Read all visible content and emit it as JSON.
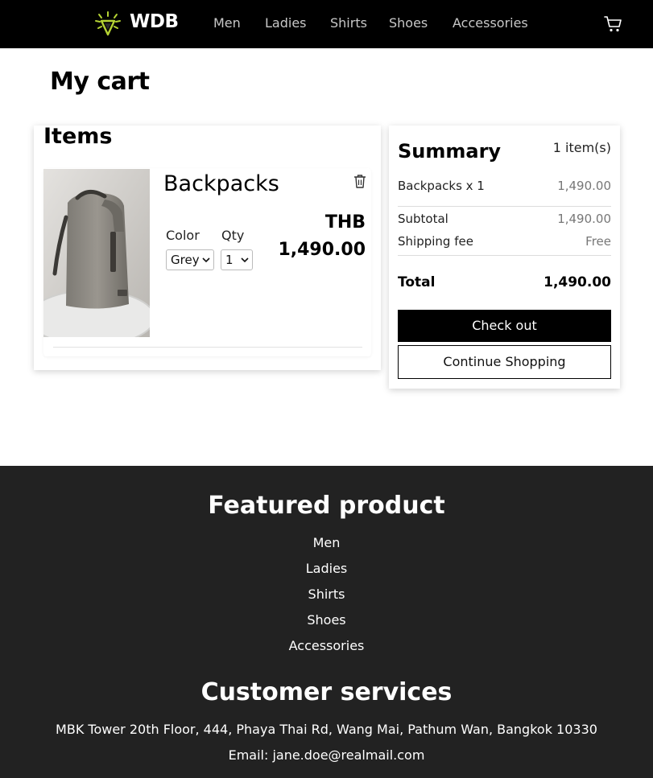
{
  "navbar": {
    "brand": "WDB",
    "links": [
      "Men",
      "Ladies",
      "Shirts",
      "Shoes",
      "Accessories"
    ],
    "logo_icon": "sun-leaf-logo",
    "cart_icon": "shopping-cart-icon"
  },
  "page": {
    "title": "My cart"
  },
  "items": {
    "title": "Items",
    "product": {
      "name": "Backpacks",
      "color_label": "Color",
      "color_value": "Grey",
      "qty_label": "Qty",
      "qty_value": "1",
      "currency": "THB",
      "price": "1,490.00",
      "delete_icon": "trash-icon"
    }
  },
  "summary": {
    "title": "Summary",
    "count": "1 item(s)",
    "line_item_label": "Backpacks x 1",
    "line_item_value": "1,490.00",
    "subtotal_label": "Subtotal",
    "subtotal_value": "1,490.00",
    "shipping_label": "Shipping fee",
    "shipping_value": "Free",
    "total_label": "Total",
    "total_value": "1,490.00",
    "checkout_label": "Check out",
    "continue_label": "Continue Shopping"
  },
  "footer": {
    "featured_title": "Featured product",
    "featured_links": [
      "Men",
      "Ladies",
      "Shirts",
      "Shoes",
      "Accessories"
    ],
    "services_title": "Customer services",
    "address": "MBK Tower 20th Floor, 444, Phaya Thai Rd, Wang Mai, Pathum Wan, Bangkok 10330",
    "email": "Email: jane.doe@realmail.com"
  },
  "colors": {
    "navbar_bg": "#000000",
    "footer_bg": "#222222",
    "logo_accent": "#b5d334",
    "checkout_bg": "#000000"
  }
}
